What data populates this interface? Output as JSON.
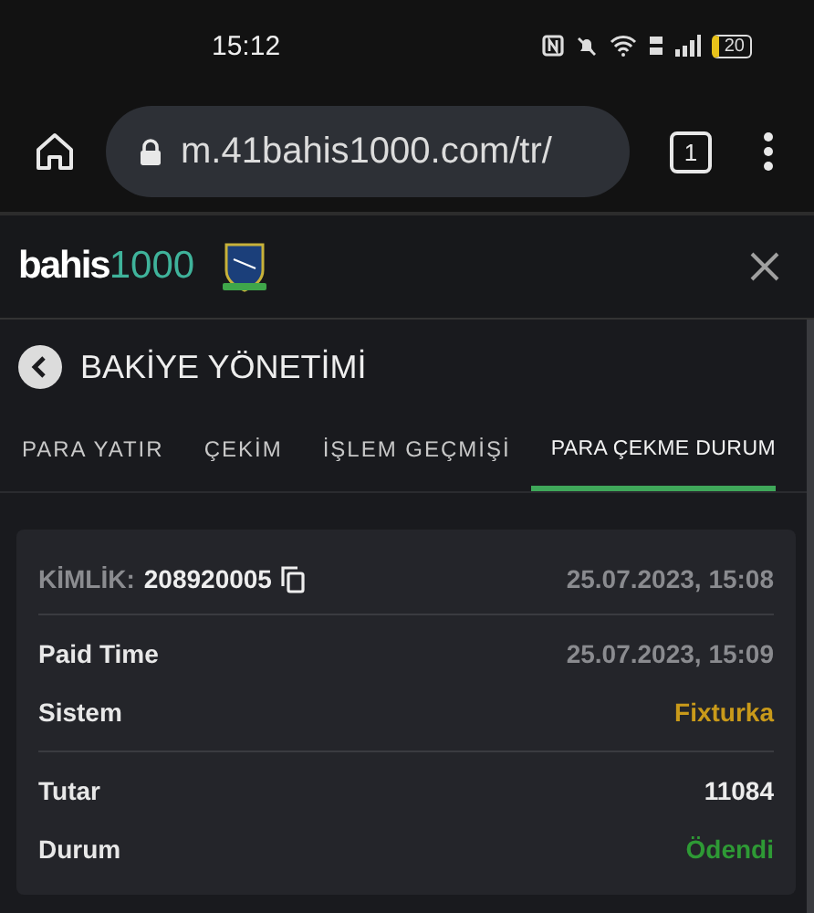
{
  "status_bar": {
    "time": "15:12",
    "battery": "20"
  },
  "browser": {
    "url": "m.41bahis1000.com/tr/",
    "tab_count": "1"
  },
  "site_header": {
    "logo_word": "bahis",
    "logo_number": "1000"
  },
  "page_title": "BAKİYE YÖNETİMİ",
  "tabs": [
    {
      "label": "PARA YATIR",
      "selected": false
    },
    {
      "label": "ÇEKİM",
      "selected": false
    },
    {
      "label": "İŞLEM GEÇMİŞİ",
      "selected": false
    },
    {
      "label": "PARA ÇEKME DURUM",
      "selected": true
    }
  ],
  "card": {
    "id_label": "KİMLİK:",
    "id_value": "208920005",
    "date": "25.07.2023, 15:08",
    "groups": [
      [
        {
          "label": "Paid Time",
          "value": "25.07.2023, 15:09",
          "color": "#8a8b8f"
        },
        {
          "label": "Sistem",
          "value": "Fixturka",
          "color": "#c99a1a"
        }
      ],
      [
        {
          "label": "Tutar",
          "value": "11084",
          "color": "#ececec"
        },
        {
          "label": "Durum",
          "value": "Ödendi",
          "color": "#2e9a35"
        }
      ]
    ]
  }
}
